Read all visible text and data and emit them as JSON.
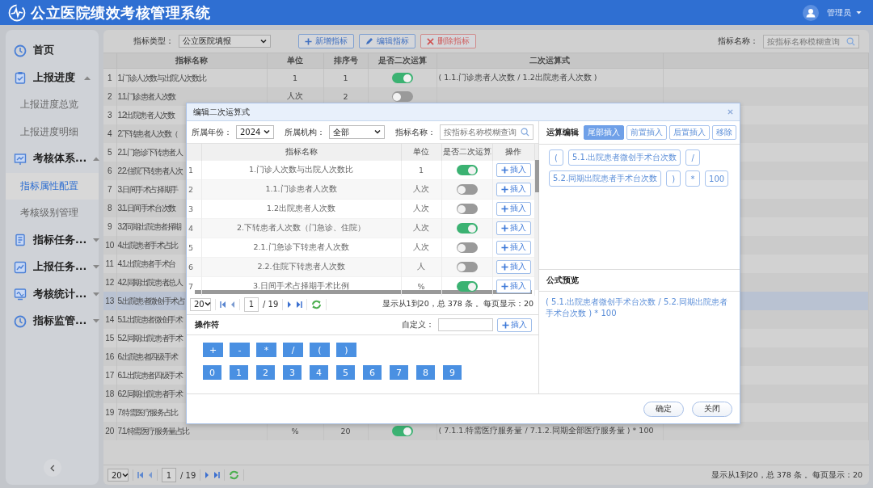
{
  "header": {
    "title": "公立医院绩效考核管理系统",
    "user": "管理员"
  },
  "sidebar": {
    "items": [
      {
        "label": "首页",
        "selected": false
      },
      {
        "label": "上报进度",
        "selected": false,
        "expanded": true,
        "children": [
          {
            "label": "上报进度总览",
            "selected": false
          },
          {
            "label": "上报进度明细",
            "selected": false
          }
        ]
      },
      {
        "label": "考核体系...",
        "selected": false,
        "expanded": true,
        "children": [
          {
            "label": "指标属性配置",
            "selected": true
          },
          {
            "label": "考核级别管理",
            "selected": false
          }
        ]
      },
      {
        "label": "指标任务...",
        "selected": false,
        "expanded": false
      },
      {
        "label": "上报任务...",
        "selected": false,
        "expanded": false
      },
      {
        "label": "考核统计...",
        "selected": false,
        "expanded": false
      },
      {
        "label": "指标监管...",
        "selected": false,
        "expanded": false
      }
    ]
  },
  "toolbar": {
    "type_label": "指标类型：",
    "type_value": "公立医院填报",
    "buttons": [
      {
        "label": "新增指标",
        "kind": "add"
      },
      {
        "label": "编辑指标",
        "kind": "edit"
      },
      {
        "label": "删除指标",
        "kind": "delete"
      }
    ],
    "search_label": "指标名称：",
    "search_placeholder": "按指标名称模糊查询"
  },
  "table": {
    "columns": [
      "指标名称",
      "单位",
      "排序号",
      "是否二次运算",
      "二次运算式"
    ],
    "rows": [
      {
        "index": "1",
        "name": "1.门诊人次数与出院人次数比",
        "unit": "1",
        "order": "1",
        "secondary": true,
        "formula": "( 1.1.门诊患者人次数 / 1.2出院患者人次数 )",
        "selected": false
      },
      {
        "index": "2",
        "name": "1.1.门诊患者人次数",
        "unit": "人次",
        "order": "2",
        "secondary": false,
        "selected": false
      },
      {
        "index": "3",
        "name": "1.2出院患者人次数",
        "selected": false
      },
      {
        "index": "4",
        "name": "2.下转患者人次数（",
        "selected": false
      },
      {
        "index": "5",
        "name": "2.1.门急诊下转患者人",
        "selected": false
      },
      {
        "index": "6",
        "name": "2.2.住院下转患者人次",
        "selected": false
      },
      {
        "index": "7",
        "name": "3.日间手术占择期手",
        "selected": false
      },
      {
        "index": "8",
        "name": "3.1.日间手术台次数",
        "selected": false
      },
      {
        "index": "9",
        "name": "3.2同期出院患者择期",
        "selected": false
      },
      {
        "index": "10",
        "name": "4.出院患者手术占比",
        "selected": false
      },
      {
        "index": "11",
        "name": "4.1.出院患者手术台",
        "selected": false
      },
      {
        "index": "12",
        "name": "4.2.同期出院患者总人",
        "selected": false
      },
      {
        "index": "13",
        "name": "5.出院患者微创手术占",
        "selected": true
      },
      {
        "index": "14",
        "name": "5.1.出院患者微创手术",
        "selected": false
      },
      {
        "index": "15",
        "name": "5.2.同期出院患者手术",
        "selected": false
      },
      {
        "index": "16",
        "name": "6.出院患者四级手术",
        "selected": false
      },
      {
        "index": "17",
        "name": "6.1.出院患者四级手术",
        "selected": false
      },
      {
        "index": "18",
        "name": "6.2.同期出院患者手术",
        "selected": false
      },
      {
        "index": "19",
        "name": "7.特需医疗服务占比",
        "selected": false
      },
      {
        "index": "20",
        "name": "7.1.特需医疗服务量占比",
        "unit": "%",
        "order": "20",
        "secondary": true,
        "formula": "( 7.1.1.特需医疗服务量 / 7.1.2.同期全部医疗服务量 ) * 100",
        "selected": false
      }
    ]
  },
  "pager": {
    "page_size": "20",
    "page": "1",
    "pages": "/ 19",
    "summary": "显示从1到20，总 378 条 。每页显示：20"
  },
  "dialog": {
    "title": "编辑二次运算式",
    "filters": [
      {
        "label": "所属年份：",
        "value": "2024"
      },
      {
        "label": "所属机构：",
        "value": "全部"
      }
    ],
    "search": {
      "label": "指标名称：",
      "placeholder": "按指标名称模糊查询"
    },
    "columns": [
      "指标名称",
      "单位",
      "是否二次运算",
      "操作"
    ],
    "rows": [
      {
        "index": "1",
        "name": "1.门诊人次数与出院人次数比",
        "unit": "1",
        "secondary": true,
        "action": "插入"
      },
      {
        "index": "2",
        "name": "1.1.门诊患者人次数",
        "unit": "人次",
        "secondary": false,
        "action": "插入"
      },
      {
        "index": "3",
        "name": "1.2出院患者人次数",
        "unit": "人次",
        "secondary": false,
        "action": "插入"
      },
      {
        "index": "4",
        "name": "2.下转患者人次数（门急诊、住院）",
        "unit": "人次",
        "secondary": true,
        "action": "插入"
      },
      {
        "index": "5",
        "name": "2.1.门急诊下转患者人次数",
        "unit": "人次",
        "secondary": false,
        "action": "插入"
      },
      {
        "index": "6",
        "name": "2.2.住院下转患者人次数",
        "unit": "人",
        "secondary": false,
        "action": "插入"
      },
      {
        "index": "7",
        "name": "3.日间手术占择期手术比例",
        "unit": "%",
        "secondary": true,
        "action": "插入"
      }
    ],
    "pager": {
      "page_size": "20",
      "page": "1",
      "pages": "/ 19",
      "summary": "显示从1到20，总 378 条 。每页显示：20"
    },
    "operators": {
      "title": "操作符",
      "custom_label": "自定义：",
      "insert": "插入",
      "symbols": [
        "+",
        "-",
        "*",
        "/",
        "(",
        ")"
      ],
      "digits": [
        "0",
        "1",
        "2",
        "3",
        "4",
        "5",
        "6",
        "7",
        "8",
        "9"
      ]
    },
    "editor": {
      "title": "运算编辑",
      "modes": [
        {
          "label": "尾部插入",
          "selected": true
        },
        {
          "label": "前置插入",
          "selected": false
        },
        {
          "label": "后置插入",
          "selected": false
        },
        {
          "label": "移除",
          "selected": false
        }
      ],
      "tokens": [
        "(",
        "5.1.出院患者微创手术台次数",
        "/",
        "5.2.同期出院患者手术台次数",
        ")",
        "*",
        "100"
      ],
      "preview_title": "公式预览",
      "preview": "( 5.1.出院患者微创手术台次数 / 5.2.同期出院患者手术台次数 ) * 100"
    },
    "buttons": [
      "确定",
      "关闭"
    ]
  }
}
